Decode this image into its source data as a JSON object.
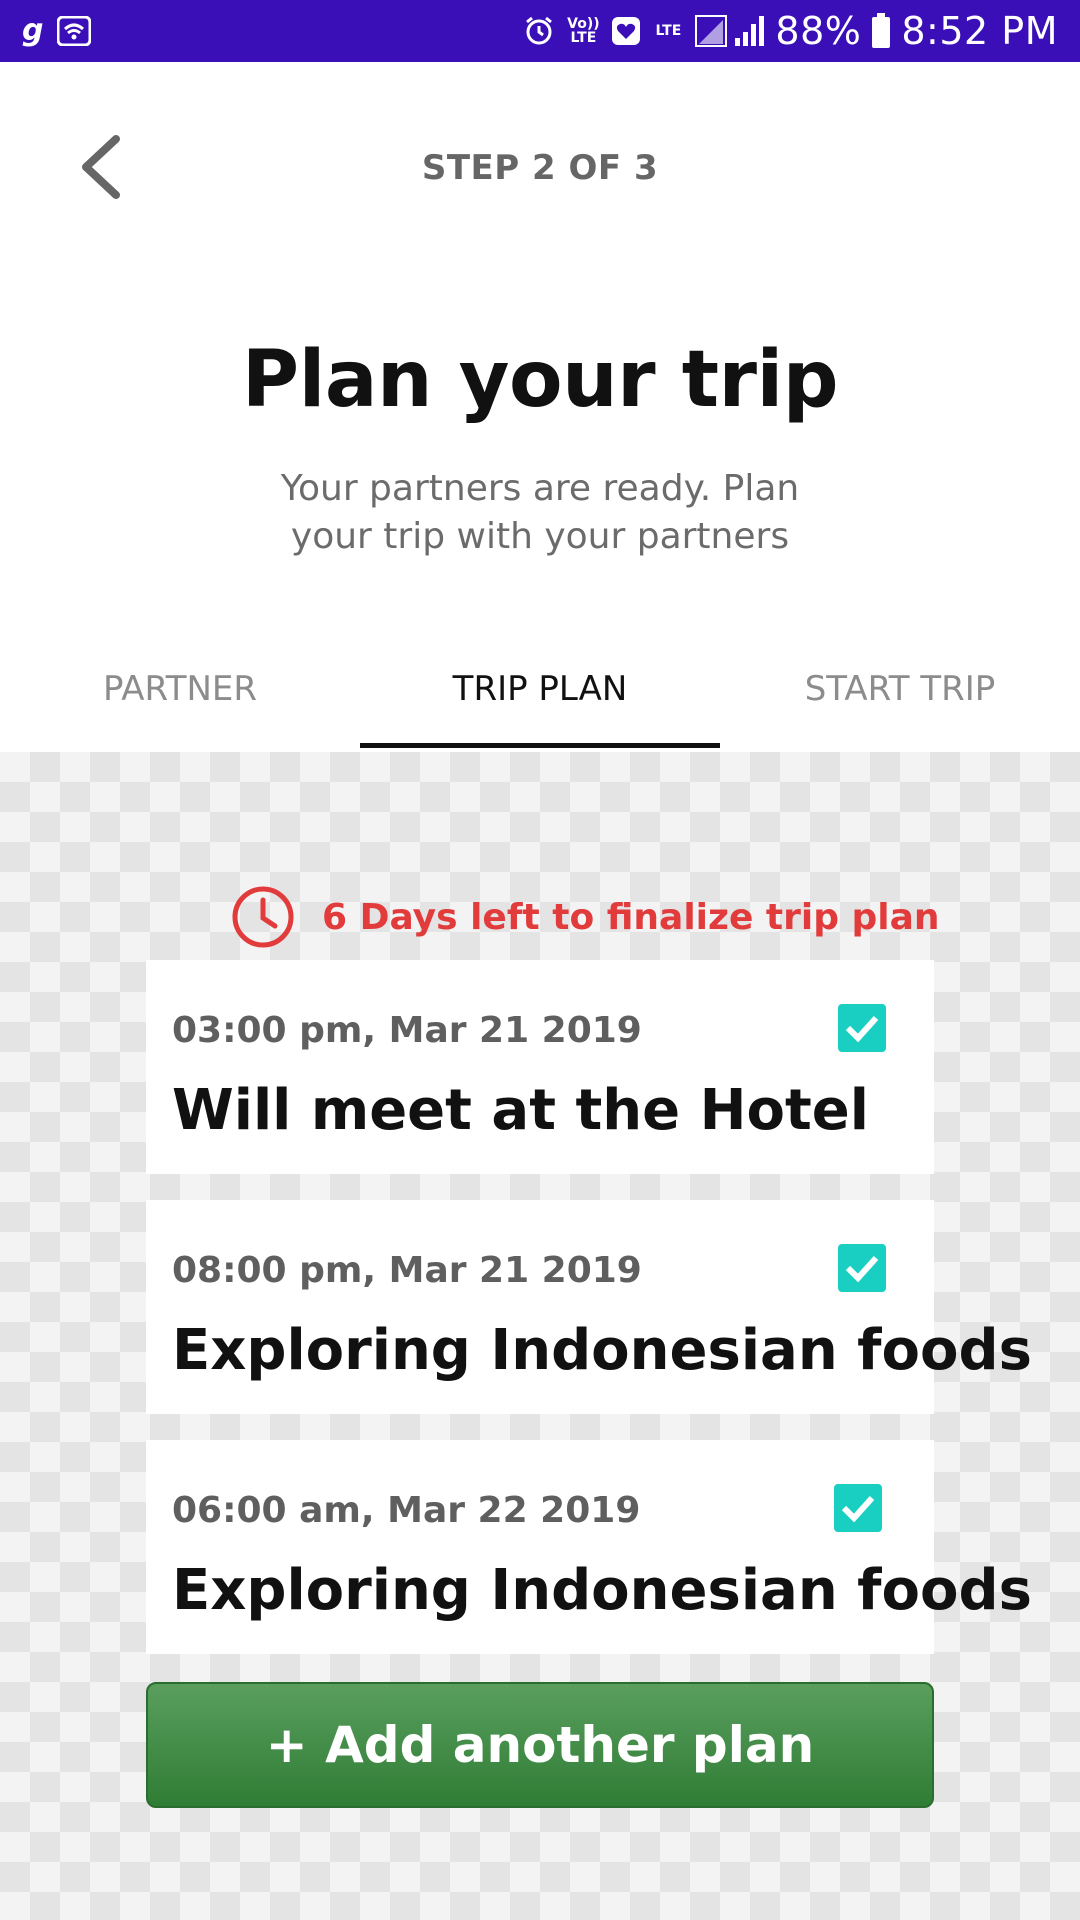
{
  "status_bar": {
    "time": "8:52 PM",
    "battery": "88%",
    "app_glyph": "g",
    "volte_label": "Vo)) LTE",
    "lte_label": "LTE",
    "icons": [
      "goibibo-app-icon",
      "wifi-icon",
      "alarm-icon",
      "volte-icon",
      "heart-icon",
      "lte-icon",
      "signal-icon",
      "battery-icon"
    ]
  },
  "header": {
    "back_icon": "chevron-left-icon",
    "step_label": "STEP 2 OF 3"
  },
  "title": "Plan your trip",
  "subtitle": "Your partners are ready. Plan your trip with your partners",
  "tabs": [
    {
      "label": "PARTNER",
      "active": false
    },
    {
      "label": "TRIP PLAN",
      "active": true
    },
    {
      "label": "START TRIP",
      "active": false
    }
  ],
  "deadline": {
    "icon": "clock-icon",
    "text": "6 Days left to finalize trip plan",
    "color": "#e23b3b"
  },
  "plans": [
    {
      "time": "03:00 pm, Mar 21 2019",
      "title": "Will meet at the Hotel",
      "checked": true
    },
    {
      "time": "08:00 pm, Mar 21 2019",
      "title": "Exploring Indonesian foods",
      "checked": true
    },
    {
      "time": "06:00 am, Mar 22 2019",
      "title": "Exploring Indonesian foods",
      "checked": true
    }
  ],
  "add_button_label": "+ Add another plan",
  "colors": {
    "status_bar": "#3a0fb8",
    "check": "#19cfc1",
    "add_button": "#3f8a44"
  }
}
